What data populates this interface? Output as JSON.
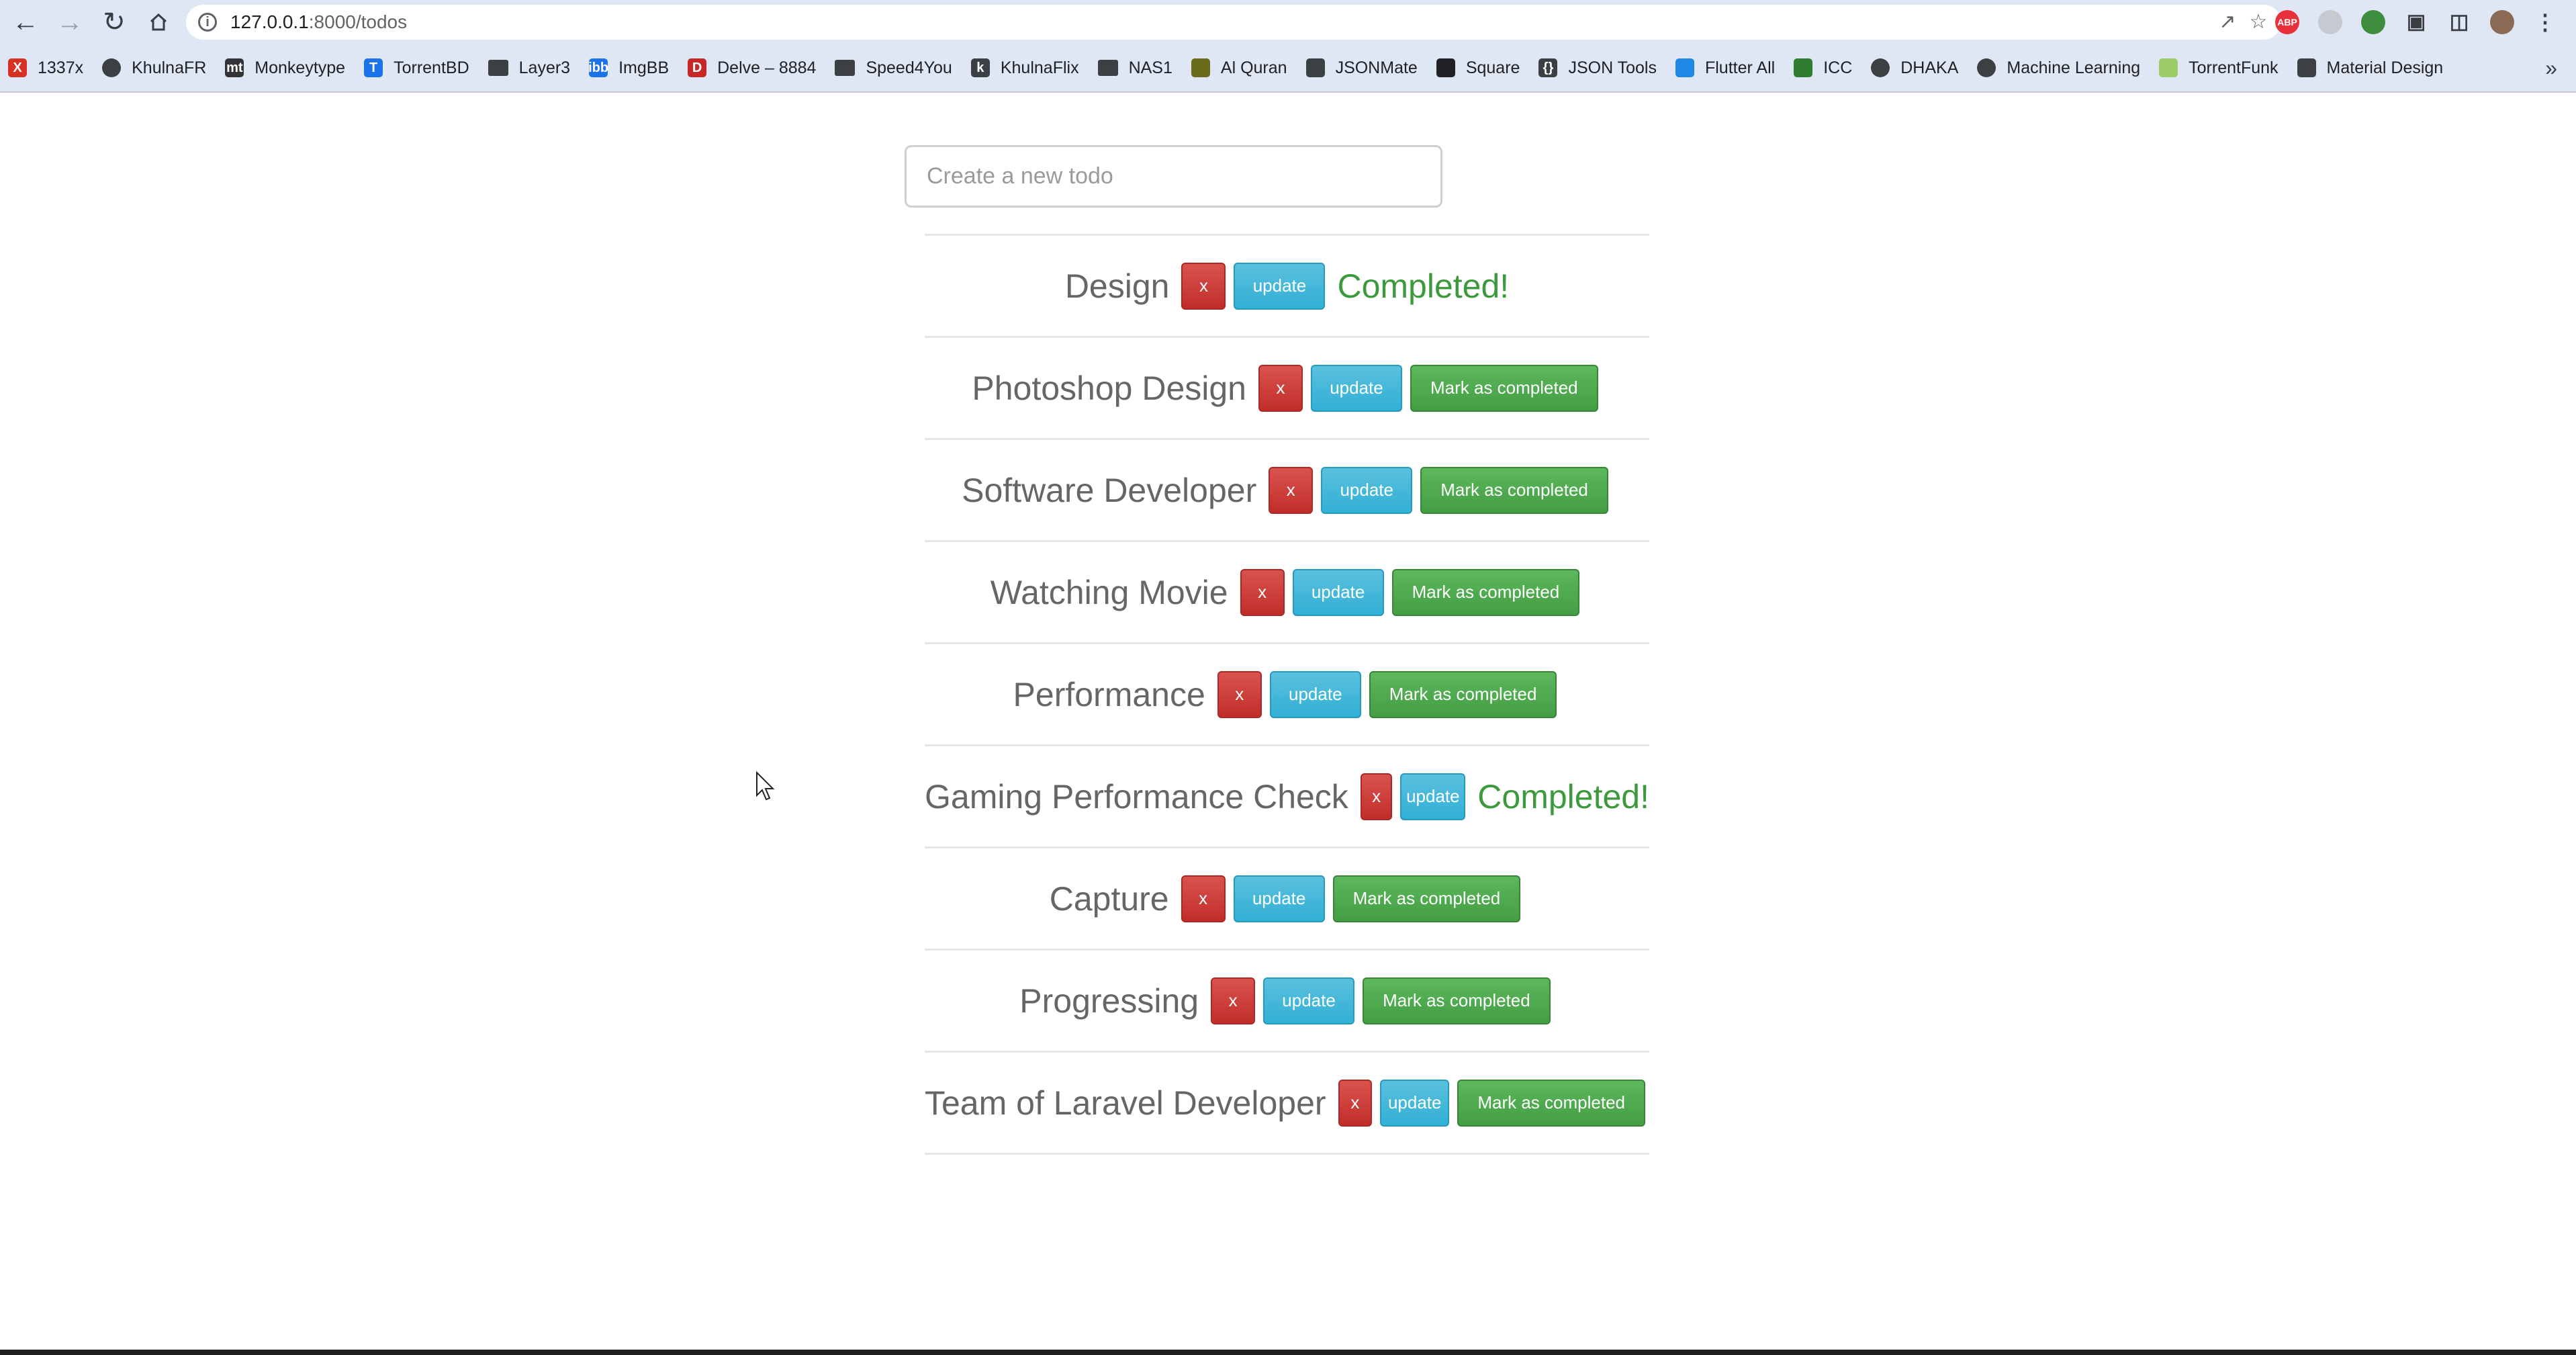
{
  "browser": {
    "url_host": "127.0.0.1",
    "url_path": ":8000/todos",
    "icons": {
      "back": "arrow-left-icon",
      "forward": "arrow-right-icon",
      "reload": "reload-icon",
      "home": "home-icon",
      "share": "share-icon",
      "star": "star-icon",
      "menu": "kebab-menu-icon"
    },
    "extensions": [
      {
        "name": "adblock-plus-icon",
        "text": "ABP",
        "color": "#e8303a"
      },
      {
        "name": "cloud-extension-icon",
        "text": "",
        "color": "#9aa0a6"
      },
      {
        "name": "globe-extension-icon",
        "text": "",
        "color": "#3f8e3f"
      },
      {
        "name": "puzzle-icon",
        "text": "",
        "color": "#3a3d42"
      },
      {
        "name": "sidebar-icon",
        "text": "",
        "color": "#3a3d42"
      },
      {
        "name": "profile-avatar",
        "text": "",
        "color": "#8a6a55"
      }
    ],
    "bookmarks": [
      {
        "label": "1337x",
        "icon": "x-logo-icon",
        "icon_text": "X",
        "color": "#d93025"
      },
      {
        "label": "KhulnaFR",
        "icon": "globe-icon",
        "icon_text": "",
        "color": "#3c4043"
      },
      {
        "label": "Monkeytype",
        "icon": "monkeytype-icon",
        "icon_text": "mt",
        "color": "#323437"
      },
      {
        "label": "TorrentBD",
        "icon": "torrentbd-icon",
        "icon_text": "T",
        "color": "#1a73e8"
      },
      {
        "label": "Layer3",
        "icon": "folder-icon",
        "icon_text": "",
        "color": "#3c4043"
      },
      {
        "label": "ImgBB",
        "icon": "imgbb-icon",
        "icon_text": "ibb",
        "color": "#1a73e8"
      },
      {
        "label": "Delve – 8884",
        "icon": "delve-icon",
        "icon_text": "D",
        "color": "#c62828"
      },
      {
        "label": "Speed4You",
        "icon": "folder-icon",
        "icon_text": "",
        "color": "#3c4043"
      },
      {
        "label": "KhulnaFlix",
        "icon": "khulnaflix-icon",
        "icon_text": "k",
        "color": "#3c4043"
      },
      {
        "label": "NAS1",
        "icon": "folder-icon",
        "icon_text": "",
        "color": "#3c4043"
      },
      {
        "label": "Al Quran",
        "icon": "quran-icon",
        "icon_text": "",
        "color": "#6b6b1e"
      },
      {
        "label": "JSONMate",
        "icon": "jsonmate-icon",
        "icon_text": "",
        "color": "#3c4043"
      },
      {
        "label": "Square",
        "icon": "square-icon",
        "icon_text": "",
        "color": "#202124"
      },
      {
        "label": "JSON Tools",
        "icon": "braces-icon",
        "icon_text": "{}",
        "color": "#3c4043"
      },
      {
        "label": "Flutter All",
        "icon": "flutter-icon",
        "icon_text": "",
        "color": "#1e88e5"
      },
      {
        "label": "ICC",
        "icon": "icc-icon",
        "icon_text": "",
        "color": "#2e7d32"
      },
      {
        "label": "DHAKA",
        "icon": "globe-icon",
        "icon_text": "",
        "color": "#3c4043"
      },
      {
        "label": "Machine Learning",
        "icon": "globe-icon",
        "icon_text": "",
        "color": "#3c4043"
      },
      {
        "label": "TorrentFunk",
        "icon": "torrentfunk-icon",
        "icon_text": "",
        "color": "#9ccc65"
      },
      {
        "label": "Material Design",
        "icon": "material-design-icon",
        "icon_text": "",
        "color": "#3c4043"
      }
    ],
    "bookmarks_more": "»"
  },
  "page": {
    "new_todo_placeholder": "Create a new todo",
    "delete_label": "x",
    "update_label": "update",
    "mark_label": "Mark as completed",
    "completed_label": "Completed!",
    "todos": [
      {
        "title": "Design",
        "completed": true
      },
      {
        "title": "Photoshop Design",
        "completed": false
      },
      {
        "title": "Software Developer",
        "completed": false
      },
      {
        "title": "Watching Movie",
        "completed": false
      },
      {
        "title": "Performance",
        "completed": false
      },
      {
        "title": "Gaming Performance Check",
        "completed": true
      },
      {
        "title": "Capture",
        "completed": false
      },
      {
        "title": "Progressing",
        "completed": false
      },
      {
        "title": "Team of Laravel Developer",
        "completed": false
      }
    ]
  },
  "colors": {
    "delete": "#d9534f",
    "update": "#5bc0de",
    "mark": "#5cb85c",
    "completed_text": "#3c9a3c"
  }
}
